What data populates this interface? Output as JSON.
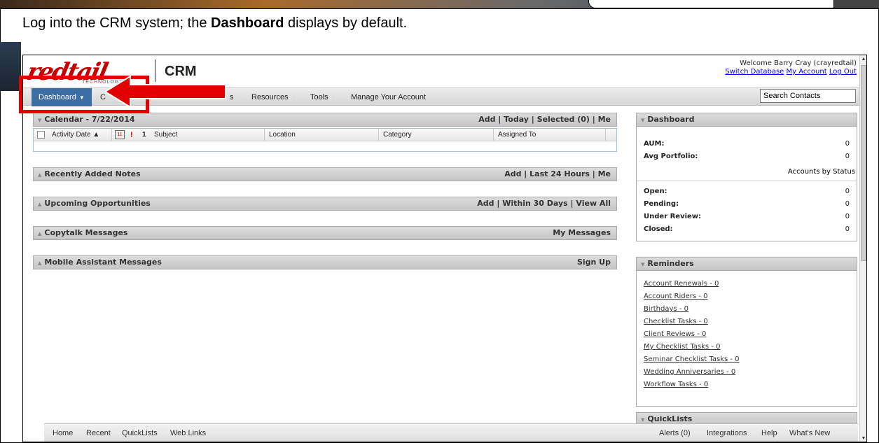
{
  "instruction": {
    "prefix": "Log into the CRM system; the ",
    "bold": "Dashboard",
    "suffix": " displays by default."
  },
  "header": {
    "logo_text": "redtail",
    "logo_sub": "TECHNOLOGY",
    "app_label": "CRM",
    "welcome": "Welcome Barry Cray (crayredtail)",
    "switch_db": "Switch Database",
    "my_account": "My Account",
    "log_out": "Log Out"
  },
  "nav": {
    "dashboard": "Dashboard",
    "contacts_partial": "C",
    "partial2": "s",
    "resources": "Resources",
    "tools": "Tools",
    "manage": "Manage Your Account",
    "search_placeholder": "Search Contacts"
  },
  "calendar": {
    "title": "Calendar - 7/22/2014",
    "links": "Add | Today | Selected (0) | Me",
    "columns": [
      "Activity Date ▲",
      "Subject",
      "Location",
      "Category",
      "Assigned To"
    ],
    "priority_mark": "!",
    "count": "1"
  },
  "panels": [
    {
      "title": "Recently Added Notes",
      "links": "Add | Last 24 Hours | Me"
    },
    {
      "title": "Upcoming Opportunities",
      "links": "Add | Within 30 Days | View All"
    },
    {
      "title": "Copytalk Messages",
      "links": "My Messages"
    },
    {
      "title": "Mobile Assistant Messages",
      "links": "Sign Up"
    }
  ],
  "dashboard_panel": {
    "title": "Dashboard",
    "aum_label": "AUM:",
    "aum_value": "0",
    "avg_label": "Avg Portfolio:",
    "avg_value": "0",
    "status_heading": "Accounts by Status",
    "statuses": [
      {
        "label": "Open:",
        "value": "0"
      },
      {
        "label": "Pending:",
        "value": "0"
      },
      {
        "label": "Under Review:",
        "value": "0"
      },
      {
        "label": "Closed:",
        "value": "0"
      }
    ]
  },
  "reminders": {
    "title": "Reminders",
    "items": [
      "Account Renewals - 0",
      "Account Riders - 0",
      "Birthdays - 0",
      "Checklist Tasks - 0",
      "Client Reviews - 0",
      "My Checklist Tasks - 0",
      "Seminar Checklist Tasks - 0",
      "Wedding Anniversaries - 0",
      "Workflow Tasks - 0"
    ]
  },
  "quicklists": {
    "title": "QuickLists"
  },
  "bottom_bar": {
    "left": [
      "Home",
      "Recent",
      "QuickLists",
      "Web Links"
    ],
    "right": [
      "Alerts (0)",
      "Integrations",
      "Help",
      "What's New"
    ]
  },
  "colors": {
    "accent": "#3b6ea5",
    "highlight": "#e30000",
    "brand": "#c40000"
  }
}
